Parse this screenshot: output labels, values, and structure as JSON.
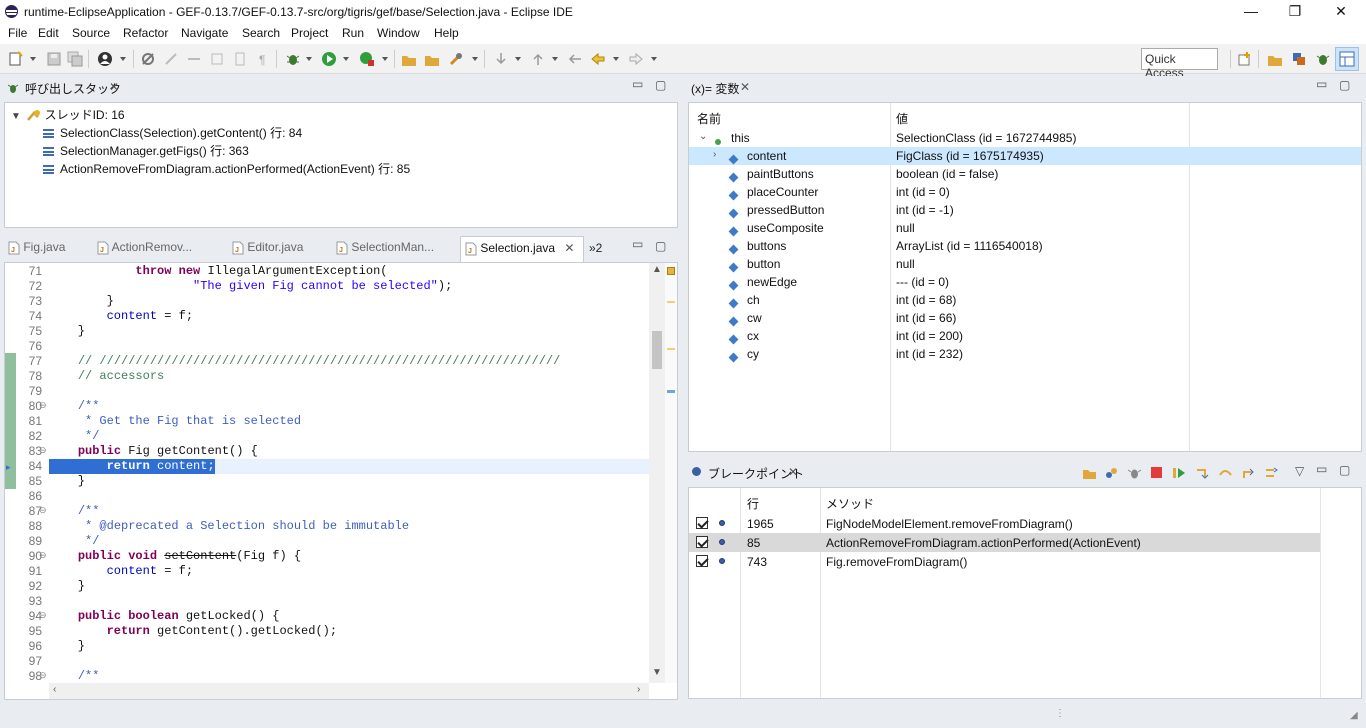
{
  "window": {
    "title": "runtime-EclipseApplication - GEF-0.13.7/GEF-0.13.7-src/org/tigris/gef/base/Selection.java - Eclipse IDE",
    "controls": [
      "—",
      "❐",
      "✕"
    ]
  },
  "menu": [
    "File",
    "Edit",
    "Source",
    "Refactor",
    "Navigate",
    "Search",
    "Project",
    "Run",
    "Window",
    "Help"
  ],
  "toolbar": {
    "quick_access": "Quick Access"
  },
  "callstack": {
    "title": "呼び出しスタック",
    "thread": "スレッドID: 16",
    "frames": [
      "SelectionClass(Selection).getContent() 行: 84",
      "SelectionManager.getFigs() 行: 363",
      "ActionRemoveFromDiagram.actionPerformed(ActionEvent) 行: 85"
    ]
  },
  "editor": {
    "tabs": [
      {
        "label": "Fig.java"
      },
      {
        "label": "ActionRemov..."
      },
      {
        "label": "Editor.java"
      },
      {
        "label": "SelectionMan..."
      },
      {
        "label": "Selection.java"
      }
    ],
    "overflow": "»2",
    "lines": [
      {
        "n": "71",
        "html": "            <span class='kw'>throw</span> <span class='kw'>new</span> IllegalArgumentException("
      },
      {
        "n": "72",
        "html": "                    <span class='str'>\"The given Fig cannot be selected\"</span>);"
      },
      {
        "n": "73",
        "html": "        }"
      },
      {
        "n": "74",
        "html": "        <span class='fld'>content</span> = f;"
      },
      {
        "n": "75",
        "html": "    }"
      },
      {
        "n": "76",
        "html": ""
      },
      {
        "n": "77",
        "html": "    <span class='cm'>// ////////////////////////////////////////////////////////////////</span>"
      },
      {
        "n": "78",
        "html": "    <span class='cm'>// accessors</span>"
      },
      {
        "n": "79",
        "html": ""
      },
      {
        "n": "80",
        "html": "    <span class='jd'>/**</span>"
      },
      {
        "n": "81",
        "html": "    <span class='jd'> * Get the Fig that is selected</span>"
      },
      {
        "n": "82",
        "html": "    <span class='jd'> */</span>"
      },
      {
        "n": "83",
        "html": "    <span class='kw'>public</span> Fig getContent() {"
      },
      {
        "n": "84",
        "html": "        <span class='kw'>return</span> <span class='fld'>content</span>;"
      },
      {
        "n": "85",
        "html": "    }"
      },
      {
        "n": "86",
        "html": ""
      },
      {
        "n": "87",
        "html": "    <span class='jd'>/**</span>"
      },
      {
        "n": "88",
        "html": "    <span class='jd'> * @deprecated a Selection should be immutable</span>"
      },
      {
        "n": "89",
        "html": "    <span class='jd'> */</span>"
      },
      {
        "n": "90",
        "html": "    <span class='kw'>public</span> <span class='kw'>void</span> <s>setContent</s>(Fig f) {"
      },
      {
        "n": "91",
        "html": "        <span class='fld'>content</span> = f;"
      },
      {
        "n": "92",
        "html": "    }"
      },
      {
        "n": "93",
        "html": ""
      },
      {
        "n": "94",
        "html": "    <span class='kw'>public</span> <span class='kw'>boolean</span> getLocked() {"
      },
      {
        "n": "95",
        "html": "        <span class='kw'>return</span> getContent().getLocked();"
      },
      {
        "n": "96",
        "html": "    }"
      },
      {
        "n": "97",
        "html": ""
      },
      {
        "n": "98",
        "html": "    <span class='jd'>/**</span>"
      }
    ]
  },
  "variables": {
    "title": "(x)= 変数",
    "columns": [
      "名前",
      "値"
    ],
    "rows": [
      {
        "name": "this",
        "value": "SelectionClass (id = 1672744985)",
        "expand": "v",
        "icon": "dot"
      },
      {
        "name": "content",
        "value": "FigClass (id = 1675174935)",
        "expand": ">",
        "icon": "diamond"
      },
      {
        "name": "paintButtons",
        "value": "boolean (id = false)",
        "icon": "diamond"
      },
      {
        "name": "placeCounter",
        "value": "int (id = 0)",
        "icon": "diamond"
      },
      {
        "name": "pressedButton",
        "value": "int (id = -1)",
        "icon": "diamond"
      },
      {
        "name": "useComposite",
        "value": "null",
        "icon": "diamond"
      },
      {
        "name": "buttons",
        "value": "ArrayList (id = 1116540018)",
        "icon": "diamond"
      },
      {
        "name": "button",
        "value": "null",
        "icon": "diamond"
      },
      {
        "name": "newEdge",
        "value": "--- (id = 0)",
        "icon": "diamond"
      },
      {
        "name": "ch",
        "value": "int (id = 68)",
        "icon": "diamond"
      },
      {
        "name": "cw",
        "value": "int (id = 66)",
        "icon": "diamond"
      },
      {
        "name": "cx",
        "value": "int (id = 200)",
        "icon": "diamond"
      },
      {
        "name": "cy",
        "value": "int (id = 232)",
        "icon": "diamond"
      }
    ]
  },
  "breakpoints": {
    "title": "ブレークポイント",
    "columns": [
      "行",
      "メソッド"
    ],
    "rows": [
      {
        "line": "1965",
        "method": "FigNodeModelElement.removeFromDiagram()"
      },
      {
        "line": "85",
        "method": "ActionRemoveFromDiagram.actionPerformed(ActionEvent)"
      },
      {
        "line": "743",
        "method": "Fig.removeFromDiagram()"
      }
    ]
  },
  "colors": {
    "selection": "#cce8ff",
    "current_line": "#2f6fd3",
    "breakpoint_selected": "#d9d9d9"
  }
}
